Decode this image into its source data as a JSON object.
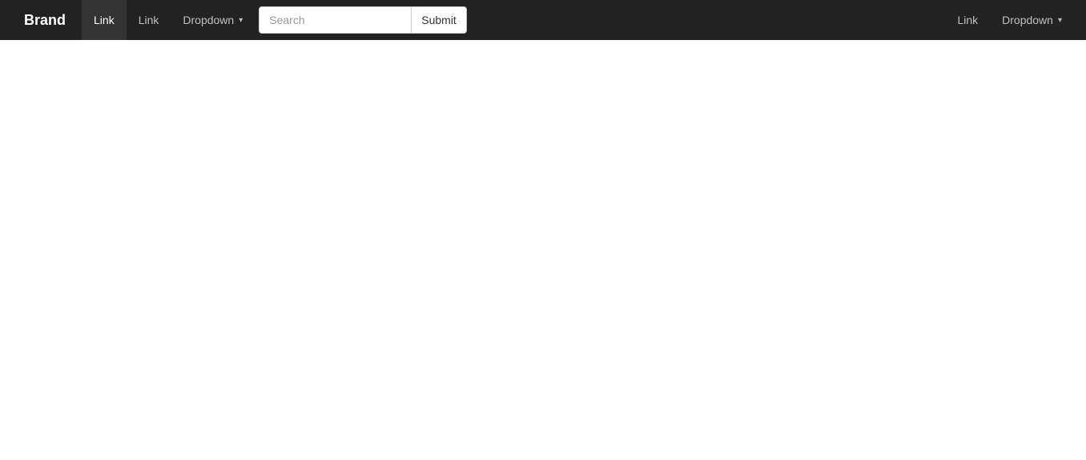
{
  "navbar": {
    "brand_label": "Brand",
    "nav_items_left": [
      {
        "label": "Link",
        "active": true,
        "type": "link"
      },
      {
        "label": "Link",
        "active": false,
        "type": "link"
      },
      {
        "label": "Dropdown",
        "active": false,
        "type": "dropdown"
      }
    ],
    "search": {
      "placeholder": "Search",
      "value": ""
    },
    "submit_label": "Submit",
    "nav_items_right": [
      {
        "label": "Link",
        "type": "link"
      },
      {
        "label": "Dropdown",
        "type": "dropdown"
      }
    ]
  }
}
